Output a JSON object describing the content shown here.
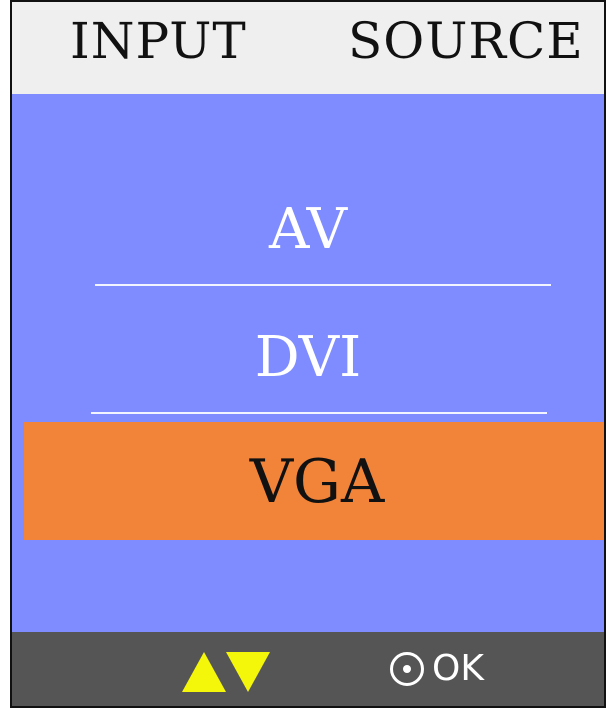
{
  "header": {
    "left_label": "INPUT",
    "right_label": "SOURCE"
  },
  "menu": {
    "items": [
      {
        "label": "AV",
        "selected": false
      },
      {
        "label": "DVI",
        "selected": false
      },
      {
        "label": "VGA",
        "selected": true
      }
    ]
  },
  "footer": {
    "nav_icons": [
      "up-arrow-icon",
      "down-arrow-icon"
    ],
    "ok_icon": "ok-circle-icon",
    "ok_label": "OK"
  },
  "colors": {
    "header_bg": "#efefef",
    "menu_bg": "#7f8cff",
    "selected_bg": "#f2843a",
    "footer_bg": "#555555",
    "arrow": "#f5f70a"
  }
}
